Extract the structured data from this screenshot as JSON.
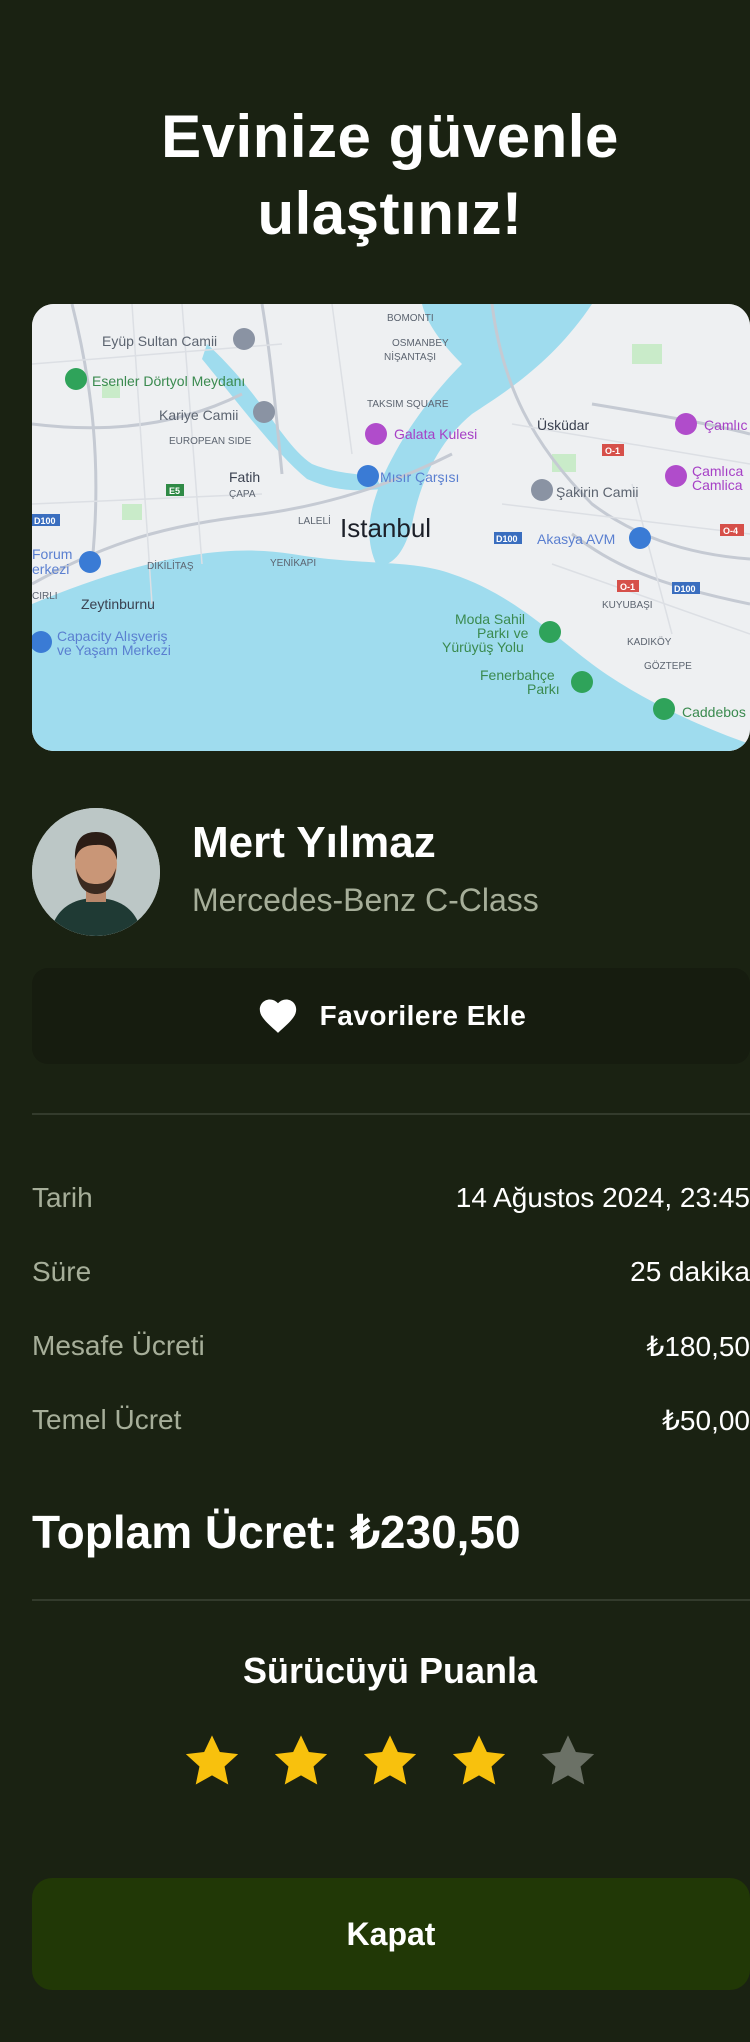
{
  "header": {
    "title_line1": "Evinize güvenle",
    "title_line2": "ulaştınız!"
  },
  "map": {
    "city_label": "Istanbul",
    "labels": [
      "Eyüp Sultan Camii",
      "BOMONTI",
      "OSMANBEY",
      "NİŞANTAŞI",
      "Esenler Dörtyol Meydanı",
      "Kariye Camii",
      "EUROPEAN SIDE",
      "TAKSIM SQUARE",
      "Galata Kulesi",
      "Üsküdar",
      "Çamlıc",
      "Fatih",
      "ÇAPA",
      "Mısır Çarşısı",
      "Çamlıca",
      "Camlica",
      "Şakirin Camii",
      "LALELİ",
      "Akasya AVM",
      "Forum",
      "erkezi",
      "DİKİLİTAŞ",
      "YENİKAPI",
      "CIRLI",
      "Zeytinburnu",
      "KUYUBAŞI",
      "Moda Sahil",
      "Parkı ve",
      "Yürüyüş Yolu",
      "Capacity Alışveriş",
      "ve Yaşam Merkezi",
      "KADIKÖY",
      "GÖZTEPE",
      "Fenerbahçe",
      "Parkı",
      "Caddebos",
      "E5",
      "D100",
      "D100",
      "D100",
      "O-1",
      "O-1",
      "O-4"
    ]
  },
  "driver": {
    "name": "Mert Yılmaz",
    "car": "Mercedes-Benz C-Class",
    "favorite_label": "Favorilere Ekle",
    "favorite_icon": "heart-icon"
  },
  "trip": {
    "rows": [
      {
        "label": "Tarih",
        "value": "14 Ağustos 2024, 23:45"
      },
      {
        "label": "Süre",
        "value": "25 dakika"
      },
      {
        "label": "Mesafe Ücreti",
        "value": "₺180,50"
      },
      {
        "label": "Temel Ücret",
        "value": "₺50,00"
      }
    ],
    "total_label": "Toplam Ücret: ₺230,50"
  },
  "rating": {
    "title": "Sürücüyü Puanla",
    "value": 4,
    "max": 5
  },
  "colors": {
    "accent_star": "#f8c10d",
    "inactive_star": "#6b7166",
    "button_bg": "#213806"
  },
  "actions": {
    "close_label": "Kapat"
  }
}
